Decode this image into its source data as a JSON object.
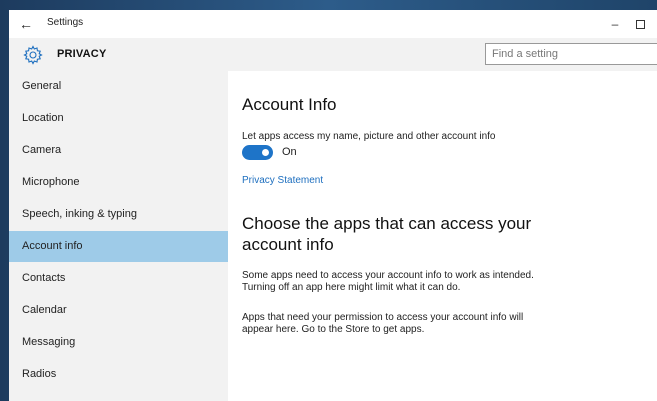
{
  "titlebar": {
    "back_icon": "back-arrow-icon",
    "title": "Settings",
    "minimize_icon": "minimize-icon",
    "maximize_icon": "maximize-icon"
  },
  "header": {
    "icon": "gear-icon",
    "title": "PRIVACY",
    "search_placeholder": "Find a setting"
  },
  "sidebar": {
    "items": [
      {
        "label": "General"
      },
      {
        "label": "Location"
      },
      {
        "label": "Camera"
      },
      {
        "label": "Microphone"
      },
      {
        "label": "Speech, inking & typing"
      },
      {
        "label": "Account info",
        "selected": true
      },
      {
        "label": "Contacts"
      },
      {
        "label": "Calendar"
      },
      {
        "label": "Messaging"
      },
      {
        "label": "Radios"
      }
    ],
    "selected_color": "#9ecbe8"
  },
  "main": {
    "section_title": "Account Info",
    "toggle_description": "Let apps access my name, picture and other account info",
    "toggle_state": "On",
    "toggle_on": true,
    "toggle_color": "#1e74c8",
    "privacy_link": "Privacy Statement",
    "apps_title": "Choose the apps that can access your account info",
    "apps_description_1": "Some apps need to access your account info to work as intended.",
    "apps_description_2": "Turning off an app here might limit what it can do.",
    "permission_note_1": "Apps that need your permission to access your account info will",
    "permission_note_2": "appear here. Go to the Store to get apps."
  }
}
